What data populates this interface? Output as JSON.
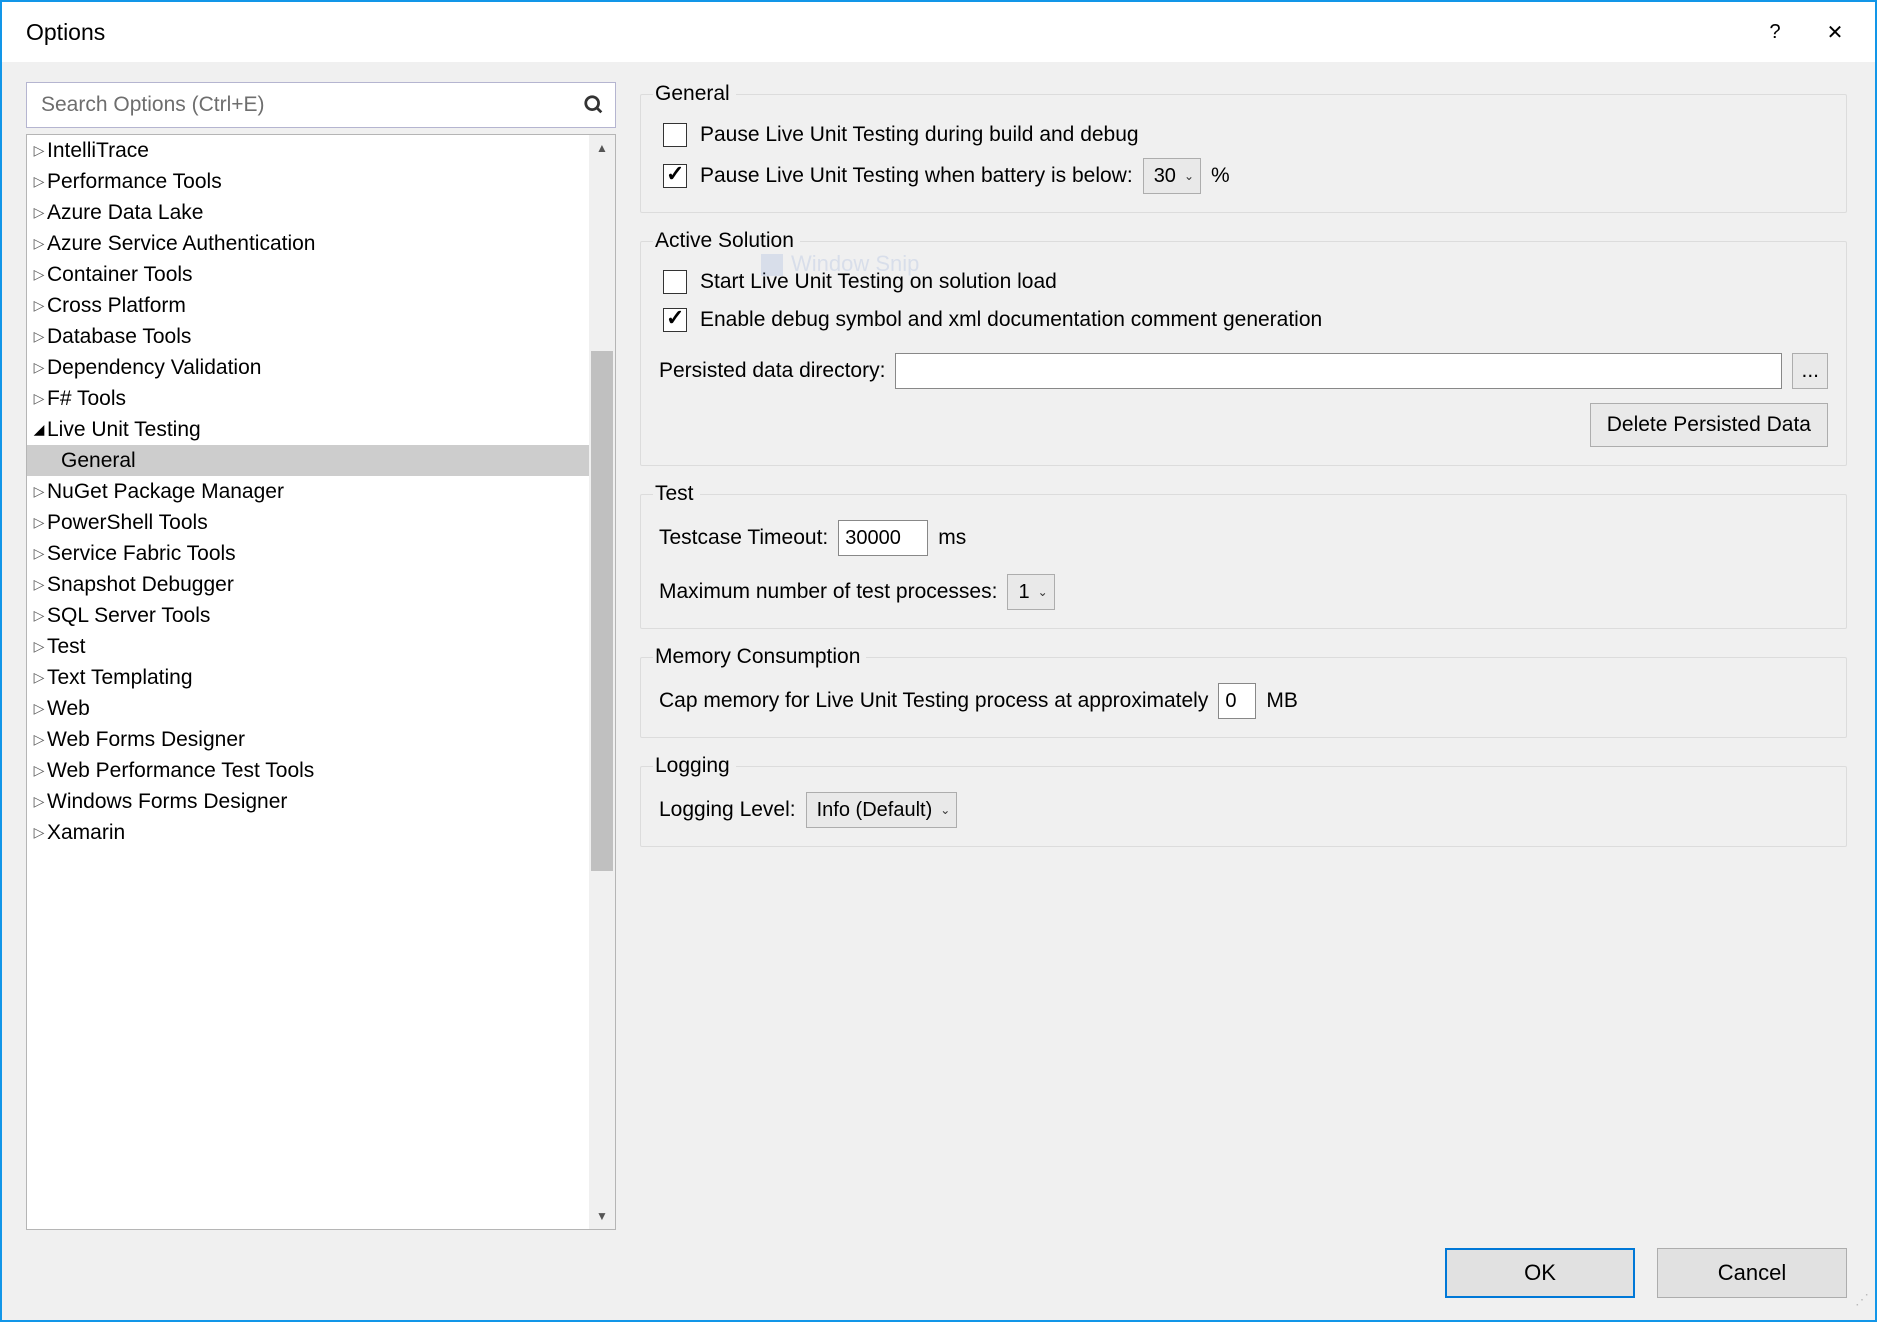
{
  "window": {
    "title": "Options",
    "help": "?",
    "close": "✕"
  },
  "search": {
    "placeholder": "Search Options (Ctrl+E)"
  },
  "tree": {
    "items": [
      {
        "label": "IntelliTrace",
        "expanded": false
      },
      {
        "label": "Performance Tools",
        "expanded": false
      },
      {
        "label": "Azure Data Lake",
        "expanded": false
      },
      {
        "label": "Azure Service Authentication",
        "expanded": false
      },
      {
        "label": "Container Tools",
        "expanded": false
      },
      {
        "label": "Cross Platform",
        "expanded": false
      },
      {
        "label": "Database Tools",
        "expanded": false
      },
      {
        "label": "Dependency Validation",
        "expanded": false
      },
      {
        "label": "F# Tools",
        "expanded": false
      },
      {
        "label": "Live Unit Testing",
        "expanded": true
      },
      {
        "label": "General",
        "child": true,
        "selected": true
      },
      {
        "label": "NuGet Package Manager",
        "expanded": false
      },
      {
        "label": "PowerShell Tools",
        "expanded": false
      },
      {
        "label": "Service Fabric Tools",
        "expanded": false
      },
      {
        "label": "Snapshot Debugger",
        "expanded": false
      },
      {
        "label": "SQL Server Tools",
        "expanded": false
      },
      {
        "label": "Test",
        "expanded": false
      },
      {
        "label": "Text Templating",
        "expanded": false
      },
      {
        "label": "Web",
        "expanded": false
      },
      {
        "label": "Web Forms Designer",
        "expanded": false
      },
      {
        "label": "Web Performance Test Tools",
        "expanded": false
      },
      {
        "label": "Windows Forms Designer",
        "expanded": false
      },
      {
        "label": "Xamarin",
        "expanded": false
      }
    ]
  },
  "general": {
    "legend": "General",
    "pause_build_label": "Pause Live Unit Testing during build and debug",
    "pause_build_checked": false,
    "pause_battery_label": "Pause Live Unit Testing when battery is below:",
    "pause_battery_checked": true,
    "battery_value": "30",
    "battery_unit": "%"
  },
  "active_solution": {
    "legend": "Active Solution",
    "start_on_load_label": "Start Live Unit Testing on solution load",
    "start_on_load_checked": false,
    "enable_debug_label": "Enable debug symbol and xml documentation comment generation",
    "enable_debug_checked": true,
    "data_dir_label": "Persisted data directory:",
    "data_dir_value": "",
    "browse_label": "...",
    "delete_label": "Delete Persisted Data"
  },
  "test": {
    "legend": "Test",
    "timeout_label": "Testcase Timeout:",
    "timeout_value": "30000",
    "timeout_unit": "ms",
    "procs_label": "Maximum number of test processes:",
    "procs_value": "1"
  },
  "memory": {
    "legend": "Memory Consumption",
    "cap_label": "Cap memory for Live Unit Testing process at approximately",
    "cap_value": "0",
    "cap_unit": "MB"
  },
  "logging": {
    "legend": "Logging",
    "level_label": "Logging Level:",
    "level_value": "Info (Default)"
  },
  "phantom": "Window Snip",
  "footer": {
    "ok": "OK",
    "cancel": "Cancel"
  }
}
